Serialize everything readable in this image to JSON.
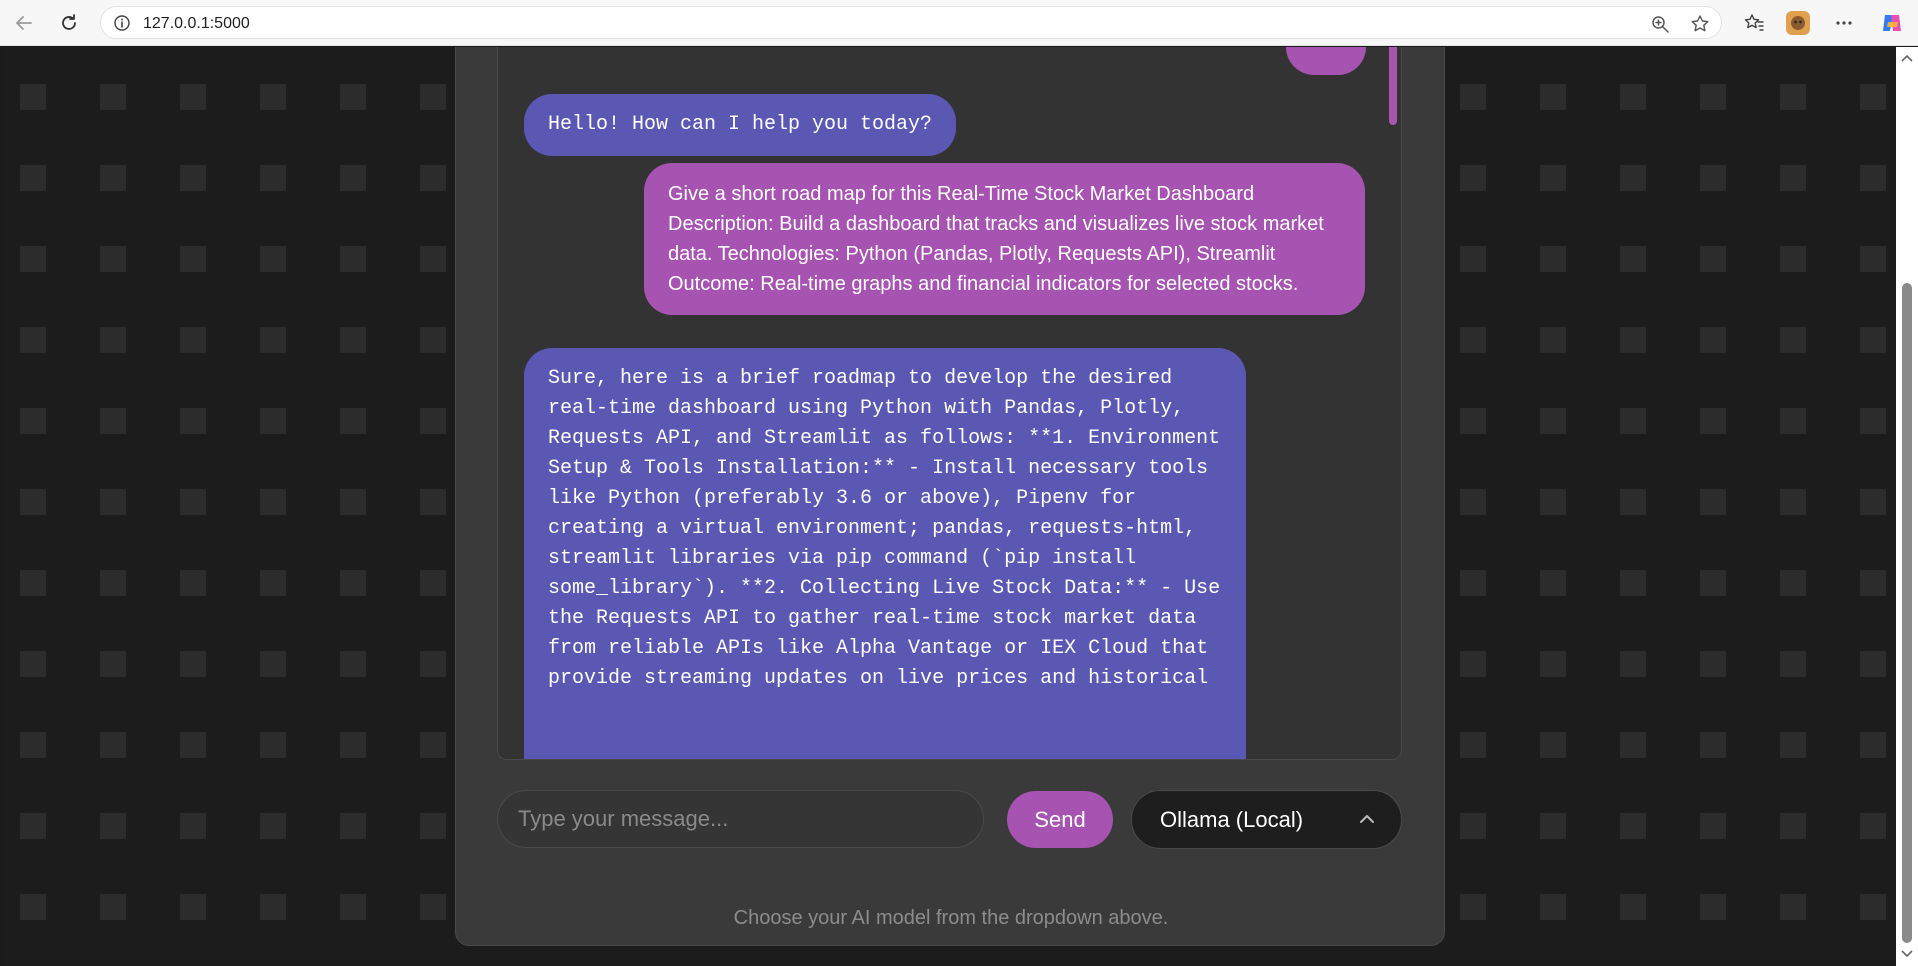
{
  "browser": {
    "url": "127.0.0.1:5000"
  },
  "chat": {
    "messages": [
      {
        "role": "bot",
        "text": "Hello! How can I help you today?"
      },
      {
        "role": "user",
        "text": "Give a short road map for this Real-Time Stock Market Dashboard Description: Build a dashboard that tracks and visualizes live stock market data. Technologies: Python (Pandas, Plotly, Requests API), Streamlit Outcome: Real-time graphs and financial indicators for selected stocks."
      },
      {
        "role": "bot",
        "text": "Sure, here is a brief roadmap to develop the desired real-time dashboard using Python with Pandas, Plotly, Requests API, and Streamlit as follows: **1. Environment Setup & Tools Installation:** - Install necessary tools like Python (preferably 3.6 or above), Pipenv for creating a virtual environment; pandas, requests-html, streamlit libraries via pip command (`pip install some_library`). **2. Collecting Live Stock Data:** - Use the Requests API to gather real-time stock market data from reliable APIs like Alpha Vantage or IEX Cloud that provide streaming updates on live prices and historical"
      }
    ],
    "input_placeholder": "Type your message...",
    "send_label": "Send",
    "model_selected": "Ollama (Local)",
    "hint": "Choose your AI model from the dropdown above."
  },
  "colors": {
    "bot_bubble": "#5a58b2",
    "user_bubble": "#a653b2",
    "card": "#3a3a3a",
    "page_bg": "#1c1c1c"
  },
  "icons": [
    "back-icon",
    "reload-icon",
    "info-icon",
    "zoom-icon",
    "star-icon",
    "favorites-icon",
    "profile-icon",
    "more-icon",
    "copilot-icon",
    "chevron-up-icon"
  ]
}
